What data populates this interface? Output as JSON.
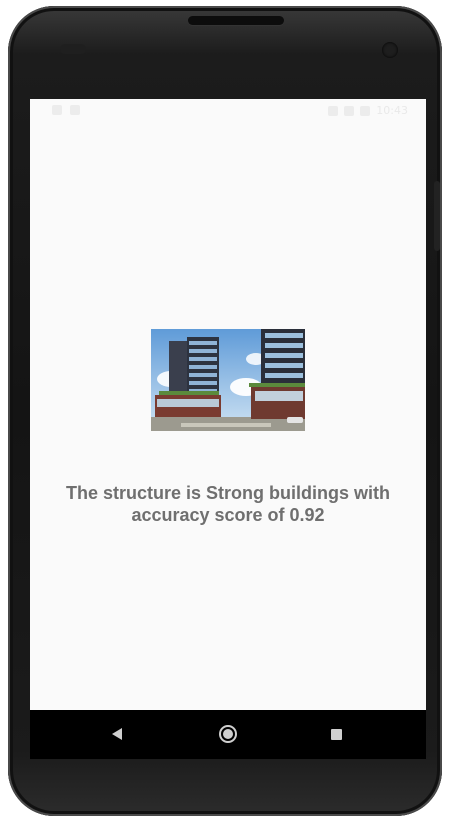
{
  "status_bar": {
    "time": "10:43"
  },
  "content": {
    "result_text": "The structure is Strong buildings with accuracy score of 0.92",
    "image_icon": "building-photo"
  },
  "nav_bar": {
    "back_icon": "back-triangle-icon",
    "home_icon": "home-circle-icon",
    "recents_icon": "recents-square-icon"
  },
  "colors": {
    "screen_bg": "#fafafa",
    "text": "#6f6f6f",
    "nav_bg": "#000000",
    "nav_icon": "#cfcfcf"
  }
}
